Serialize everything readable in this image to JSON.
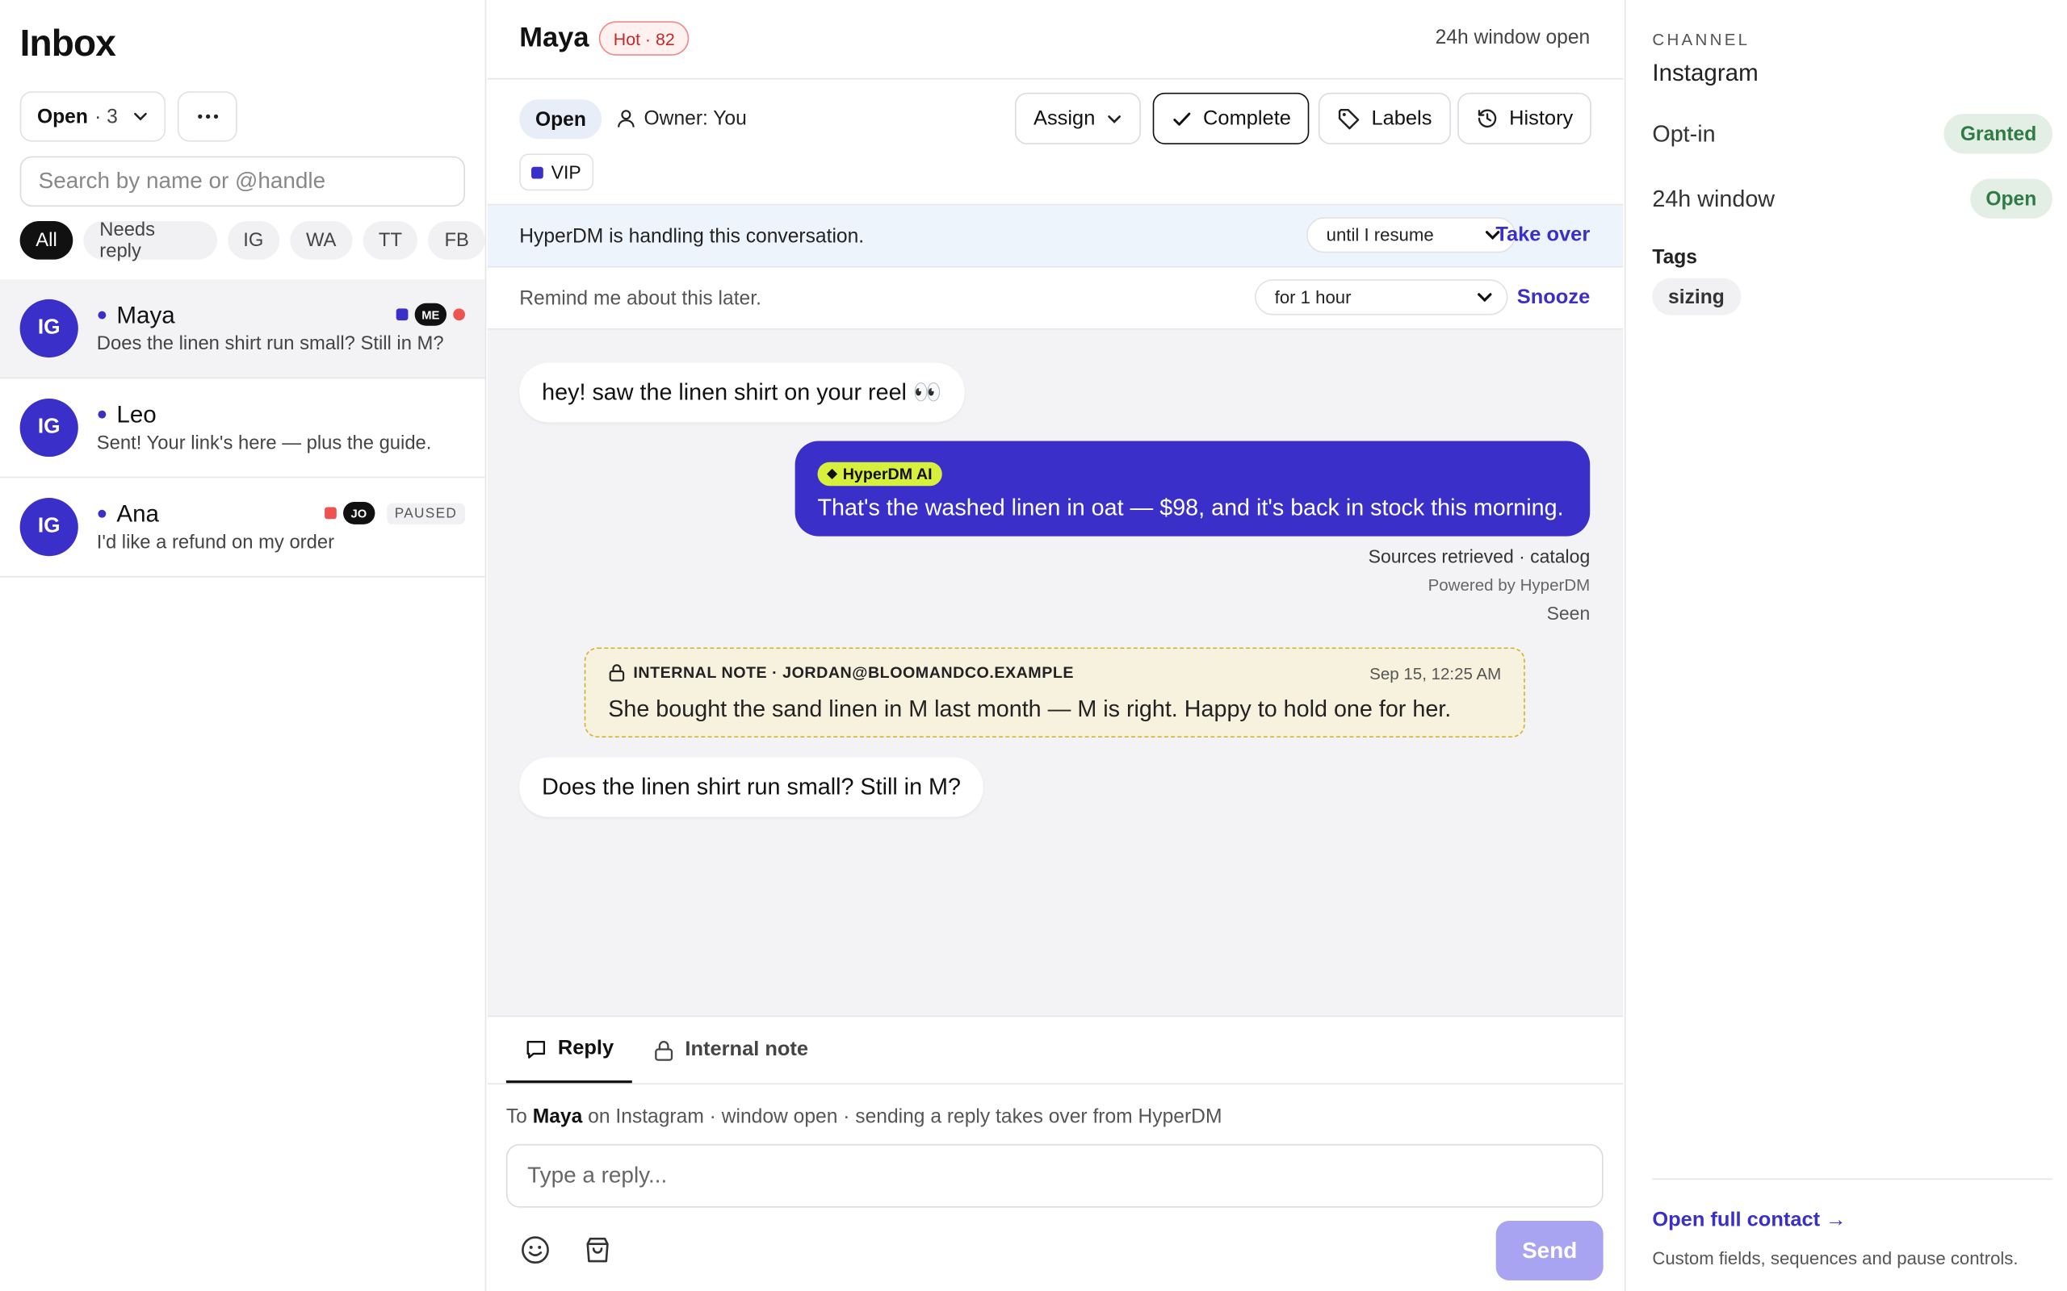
{
  "sidebar": {
    "title": "Inbox",
    "status_filter": {
      "label": "Open",
      "count": "· 3"
    },
    "search_placeholder": "Search by name or @handle",
    "filters": [
      {
        "label": "All",
        "active": true
      },
      {
        "label": "Needs reply",
        "active": false
      },
      {
        "label": "IG",
        "active": false
      },
      {
        "label": "WA",
        "active": false
      },
      {
        "label": "TT",
        "active": false
      },
      {
        "label": "FB",
        "active": false
      }
    ],
    "conversations": [
      {
        "channel": "IG",
        "name": "Maya",
        "preview": "Does the linen shirt run small? Still in M?",
        "assignee_initials": "ME",
        "unread": true,
        "selected": true,
        "square_color": "#3b2fc9"
      },
      {
        "channel": "IG",
        "name": "Leo",
        "preview": "Sent! Your link's here — plus the guide.",
        "unread": true,
        "selected": false
      },
      {
        "channel": "IG",
        "name": "Ana",
        "preview": "I'd like a refund on my order",
        "assignee_initials": "JO",
        "status": "PAUSED",
        "unread": true,
        "selected": false,
        "square_color": "#ef5350"
      }
    ]
  },
  "header": {
    "name": "Maya",
    "score_badge": "Hot · 82",
    "window_status": "24h window open"
  },
  "actions": {
    "status": "Open",
    "owner": "Owner: You",
    "assign": "Assign",
    "complete": "Complete",
    "labels": "Labels",
    "history": "History",
    "vip_label": "VIP"
  },
  "ai_bar": {
    "text": "HyperDM is handling this conversation.",
    "duration": "until I resume",
    "action": "Take over"
  },
  "snooze_bar": {
    "text": "Remind me about this later.",
    "duration": "for 1 hour",
    "action": "Snooze"
  },
  "messages": {
    "first_in": "hey! saw the linen shirt on your reel 👀",
    "ai_badge": "HyperDM AI",
    "ai_reply": "That's the washed linen in oat — $98, and it's back in stock this morning.",
    "sources": "Sources retrieved · catalog",
    "powered": "Powered by HyperDM",
    "seen": "Seen",
    "note_header": "INTERNAL NOTE · JORDAN@BLOOMANDCO.EXAMPLE",
    "note_time": "Sep 15, 12:25 AM",
    "note_text": "She bought the sand linen in M last month — M is right. Happy to hold one for her.",
    "last_in": "Does the linen shirt run small? Still in M?"
  },
  "composer": {
    "tab_reply": "Reply",
    "tab_note": "Internal note",
    "to_prefix": "To",
    "to_name": "Maya",
    "to_suffix": "on Instagram · window open · sending a reply takes over from HyperDM",
    "placeholder": "Type a reply...",
    "send": "Send"
  },
  "panel": {
    "channel_heading": "CHANNEL",
    "channel": "Instagram",
    "optin_label": "Opt-in",
    "optin_value": "Granted",
    "window_label": "24h window",
    "window_value": "Open",
    "tags_heading": "Tags",
    "tag": "sizing",
    "contact_link": "Open full contact →",
    "contact_sub": "Custom fields, sequences and pause controls."
  },
  "colors": {
    "accent": "#3b2fc9",
    "ai_chip": "#d6f03c",
    "note_bg": "#f7f2de",
    "hot": "#c62828"
  }
}
